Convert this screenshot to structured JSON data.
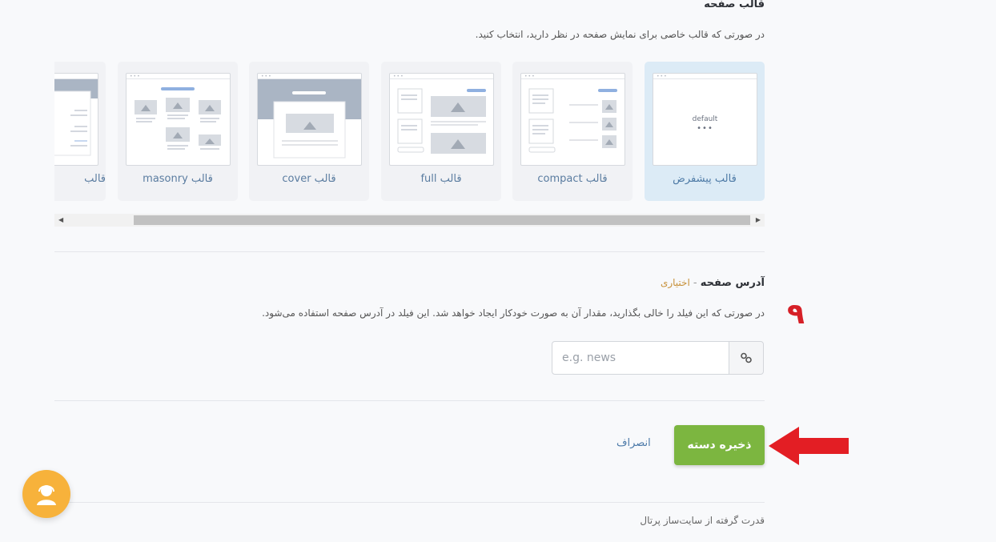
{
  "section": {
    "title": "قالب صفحه",
    "description": "در صورتی که قالب خاصی برای نمایش صفحه در نظر دارید، انتخاب کنید."
  },
  "templates": [
    {
      "label": "قالب پیشفرض",
      "thumb_text": "default",
      "selected": true
    },
    {
      "label": "قالب compact"
    },
    {
      "label": "قالب full"
    },
    {
      "label": "قالب cover"
    },
    {
      "label": "قالب masonry"
    },
    {
      "label": "قالب"
    }
  ],
  "address": {
    "title": "آدرس صفحه",
    "separator": " - ",
    "optional": "اختیاری",
    "description": "در صورتی که این فیلد را خالی بگذارید، مقدار آن به صورت خودکار ایجاد خواهد شد. این فیلد در آدرس صفحه استفاده می‌شود.",
    "placeholder": "e.g. news",
    "value": ""
  },
  "annotation": {
    "step_number": "۹",
    "color": "#d62027"
  },
  "actions": {
    "save_label": "ذخیره دسته",
    "cancel_label": "انصراف"
  },
  "footer": {
    "text": "قدرت گرفته از سایت‌ساز پرتال"
  },
  "colors": {
    "accent_green": "#7cb640",
    "link_blue": "#4b79a8",
    "selected_card": "#dcebf6",
    "support_orange": "#f7b23b"
  }
}
